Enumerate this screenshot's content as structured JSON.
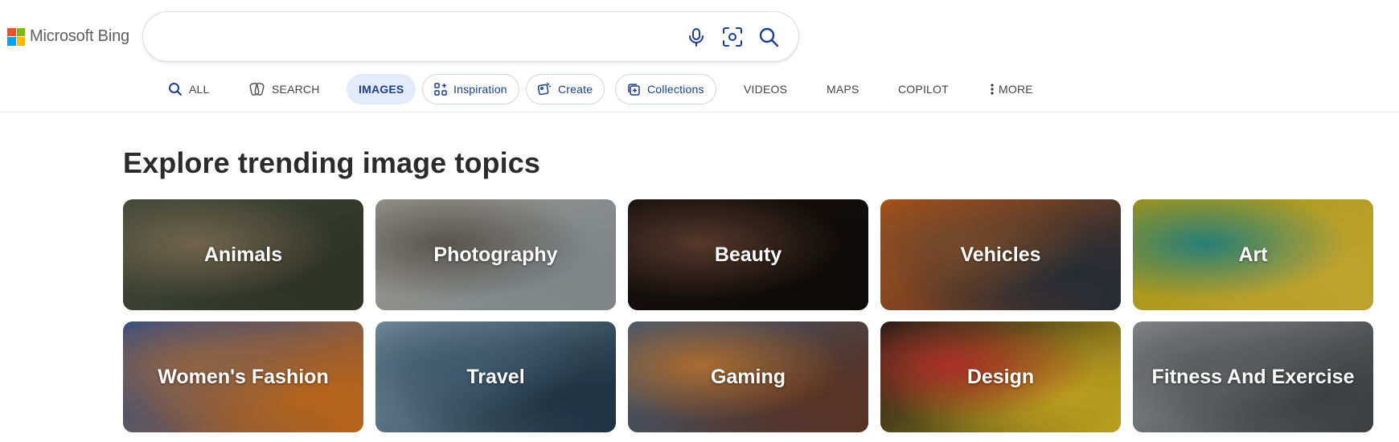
{
  "brand": {
    "name": "Microsoft Bing",
    "logo_colors": [
      "#F25022",
      "#7FBA00",
      "#00A4EF",
      "#FFB900"
    ]
  },
  "search": {
    "value": "",
    "placeholder": "",
    "icons": [
      "microphone-icon",
      "visual-search-icon",
      "search-icon"
    ],
    "accent": "#1a3f8f"
  },
  "nav": {
    "all": "ALL",
    "search": "SEARCH",
    "images": "IMAGES",
    "inspiration": "Inspiration",
    "create": "Create",
    "collections": "Collections",
    "videos": "VIDEOS",
    "maps": "MAPS",
    "copilot": "COPILOT",
    "more": "MORE"
  },
  "main": {
    "title": "Explore trending image topics",
    "topics": [
      {
        "label": "Animals",
        "colors": [
          "#4c5740",
          "#8a7c5d",
          "#3a3f2d"
        ]
      },
      {
        "label": "Photography",
        "colors": [
          "#b8b5ae",
          "#6d6760",
          "#9aa3a6"
        ]
      },
      {
        "label": "Beauty",
        "colors": [
          "#1b1512",
          "#6a4532",
          "#120e0c"
        ]
      },
      {
        "label": "Vehicles",
        "colors": [
          "#d9651c",
          "#8f5a34",
          "#2c3540"
        ]
      },
      {
        "label": "Art",
        "colors": [
          "#c9b51a",
          "#2f9b93",
          "#e8c73a"
        ]
      },
      {
        "label": "Women's Fashion",
        "colors": [
          "#3c5fa7",
          "#b07a54",
          "#e07a1f"
        ]
      },
      {
        "label": "Travel",
        "colors": [
          "#8eaec3",
          "#4f7087",
          "#233d52"
        ]
      },
      {
        "label": "Gaming",
        "colors": [
          "#4f6b8a",
          "#d0843c",
          "#6b3f2c"
        ]
      },
      {
        "label": "Design",
        "colors": [
          "#1e1e1e",
          "#d13b2f",
          "#e4c226"
        ]
      },
      {
        "label": "Fitness And Exercise",
        "colors": [
          "#a4a8aa",
          "#6f7376",
          "#4a4e51"
        ]
      }
    ]
  }
}
